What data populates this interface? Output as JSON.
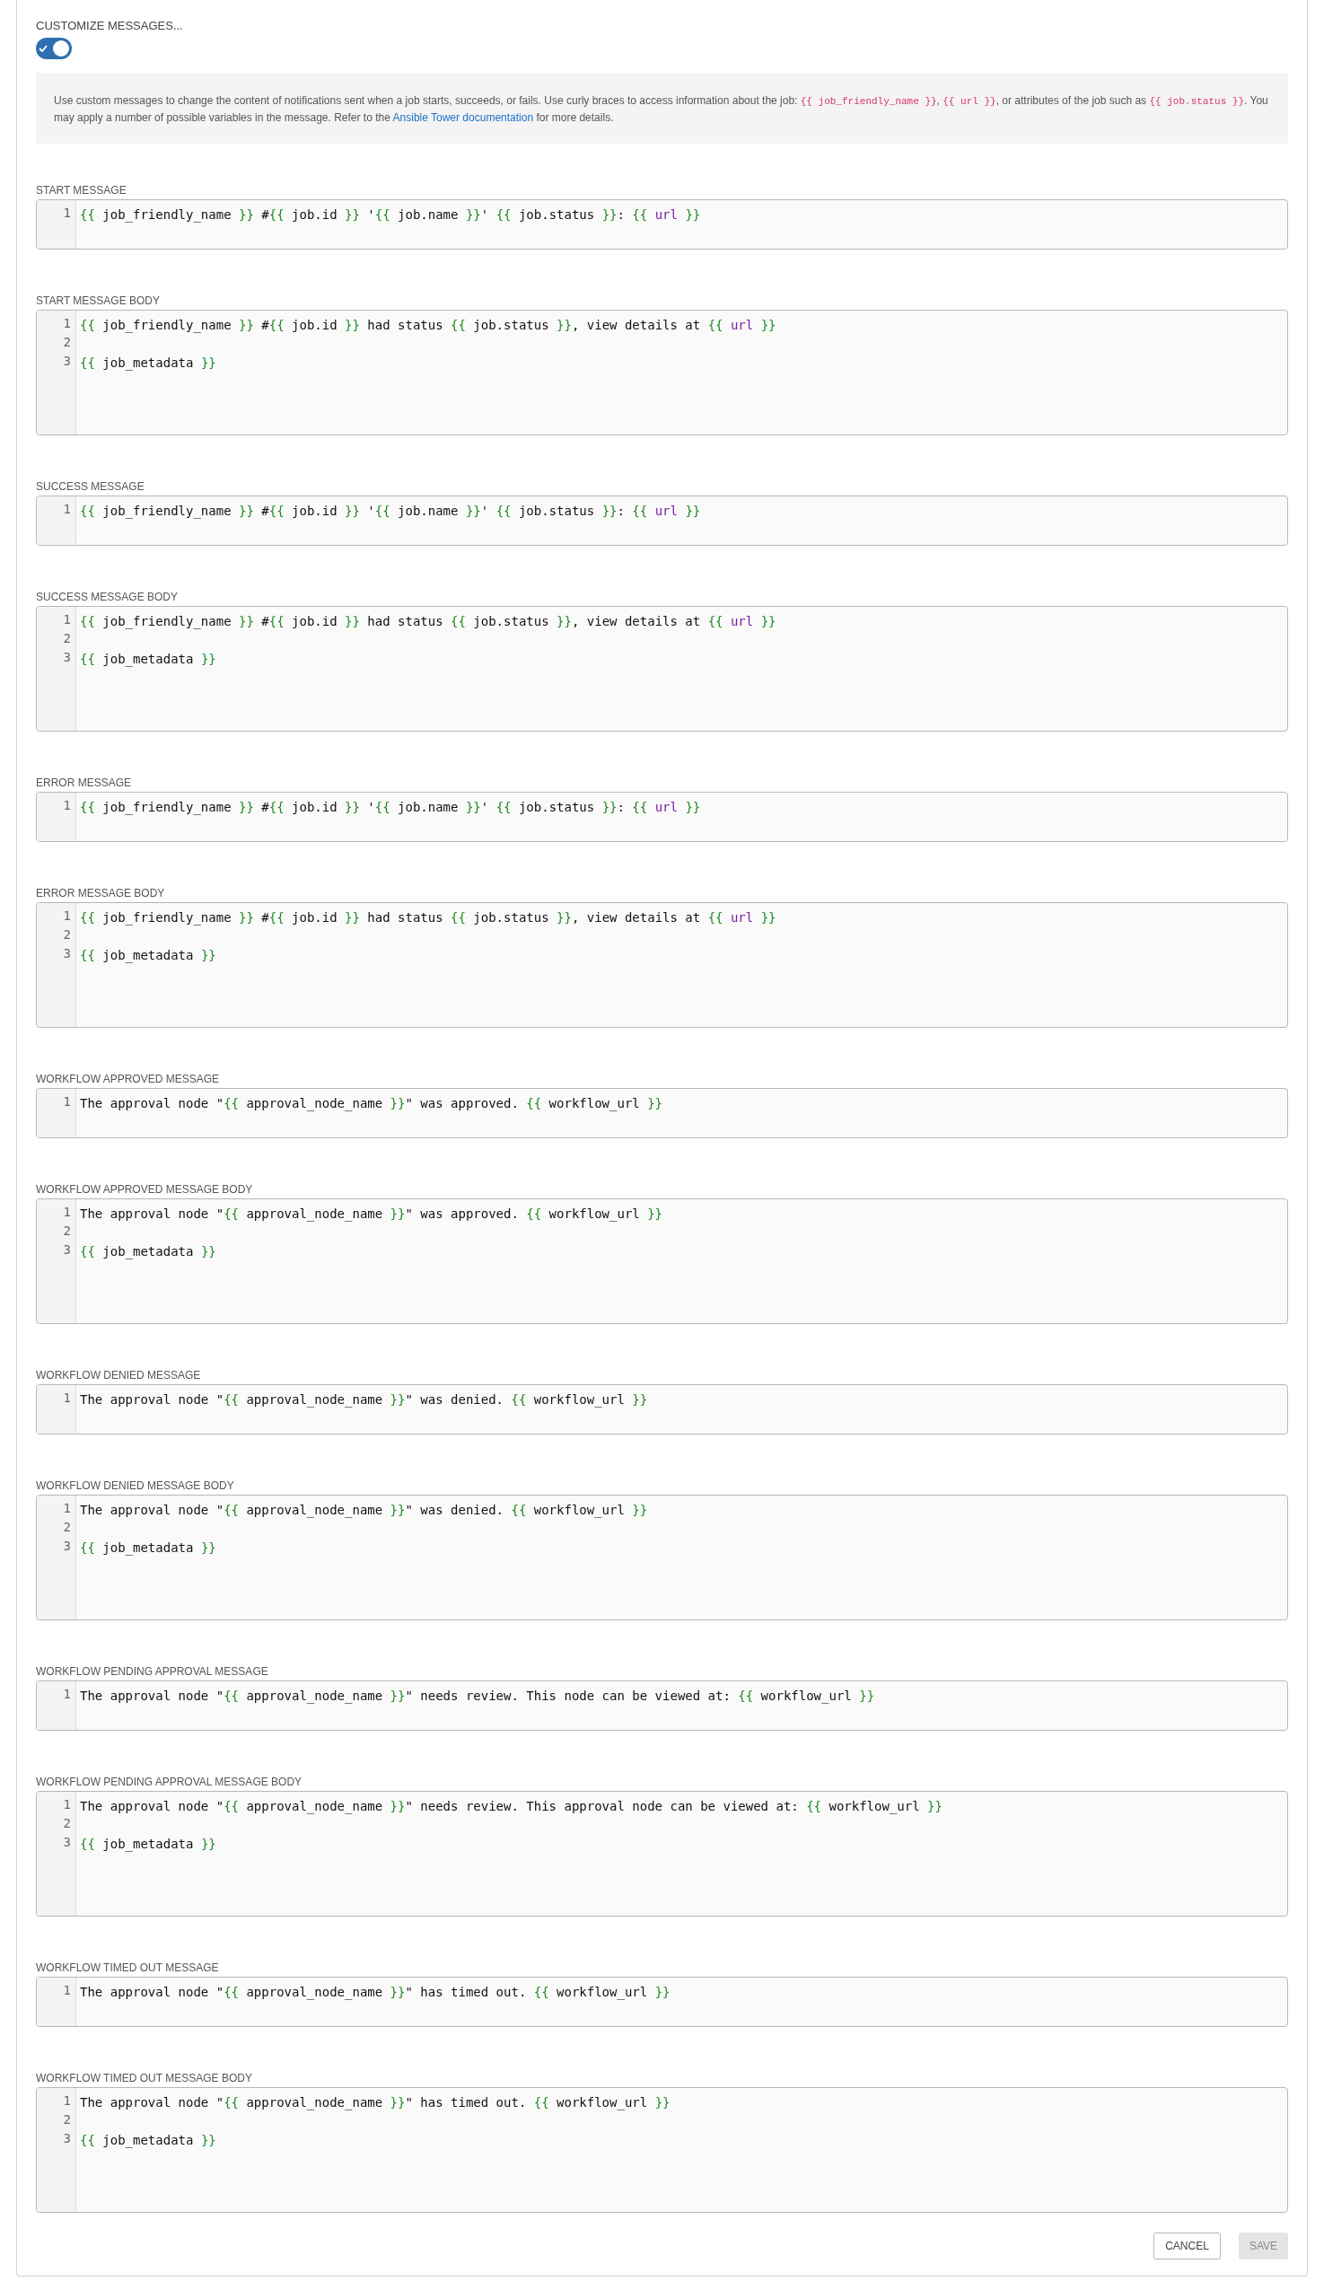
{
  "customize": {
    "label": "CUSTOMIZE MESSAGES...",
    "on": true
  },
  "info": [
    {
      "kind": "text",
      "text": "Use custom messages to change the content of notifications sent when a job starts, succeeds, or fails. Use curly braces to access information about the job: "
    },
    {
      "kind": "code",
      "text": "{{ job_friendly_name }}"
    },
    {
      "kind": "text",
      "text": ", "
    },
    {
      "kind": "code",
      "text": "{{ url }}"
    },
    {
      "kind": "text",
      "text": ", or attributes of the job such as "
    },
    {
      "kind": "code",
      "text": "{{ job.status }}"
    },
    {
      "kind": "text",
      "text": ". You may apply a number of possible variables in the message. Refer to the "
    },
    {
      "kind": "link",
      "text": "Ansible Tower documentation"
    },
    {
      "kind": "text",
      "text": " for more details."
    }
  ],
  "messages": [
    {
      "label": "START MESSAGE",
      "kind": "subject",
      "lines": [
        {
          "number": "1",
          "segments": [
            {
              "kind": "brace",
              "text": "{{"
            },
            {
              "kind": "plain",
              "text": " job_friendly_name "
            },
            {
              "kind": "brace",
              "text": "}}"
            },
            {
              "kind": "plain",
              "text": " #"
            },
            {
              "kind": "brace",
              "text": "{{"
            },
            {
              "kind": "plain",
              "text": " job.id "
            },
            {
              "kind": "brace",
              "text": "}}"
            },
            {
              "kind": "plain",
              "text": " '"
            },
            {
              "kind": "brace",
              "text": "{{"
            },
            {
              "kind": "plain",
              "text": " job.name "
            },
            {
              "kind": "brace",
              "text": "}}"
            },
            {
              "kind": "plain",
              "text": "' "
            },
            {
              "kind": "brace",
              "text": "{{"
            },
            {
              "kind": "plain",
              "text": " job.status "
            },
            {
              "kind": "brace",
              "text": "}}"
            },
            {
              "kind": "plain",
              "text": ": "
            },
            {
              "kind": "brace",
              "text": "{{ "
            },
            {
              "kind": "keyword",
              "text": "url"
            },
            {
              "kind": "brace",
              "text": " }}"
            }
          ]
        }
      ]
    },
    {
      "label": "START MESSAGE BODY",
      "kind": "body",
      "lines": [
        {
          "number": "1",
          "segments": [
            {
              "kind": "brace",
              "text": "{{"
            },
            {
              "kind": "plain",
              "text": " job_friendly_name "
            },
            {
              "kind": "brace",
              "text": "}}"
            },
            {
              "kind": "plain",
              "text": " #"
            },
            {
              "kind": "brace",
              "text": "{{"
            },
            {
              "kind": "plain",
              "text": " job.id "
            },
            {
              "kind": "brace",
              "text": "}}"
            },
            {
              "kind": "plain",
              "text": " had status "
            },
            {
              "kind": "brace",
              "text": "{{"
            },
            {
              "kind": "plain",
              "text": " job.status "
            },
            {
              "kind": "brace",
              "text": "}}"
            },
            {
              "kind": "plain",
              "text": ", view details at "
            },
            {
              "kind": "brace",
              "text": "{{ "
            },
            {
              "kind": "keyword",
              "text": "url"
            },
            {
              "kind": "brace",
              "text": " }}"
            }
          ]
        },
        {
          "number": "2"
        },
        {
          "number": "3",
          "segments": [
            {
              "kind": "brace",
              "text": "{{"
            },
            {
              "kind": "plain",
              "text": " job_metadata "
            },
            {
              "kind": "brace",
              "text": "}}"
            }
          ]
        }
      ]
    },
    {
      "label": "SUCCESS MESSAGE",
      "kind": "subject",
      "lines": [
        {
          "number": "1",
          "segments": [
            {
              "kind": "brace",
              "text": "{{"
            },
            {
              "kind": "plain",
              "text": " job_friendly_name "
            },
            {
              "kind": "brace",
              "text": "}}"
            },
            {
              "kind": "plain",
              "text": " #"
            },
            {
              "kind": "brace",
              "text": "{{"
            },
            {
              "kind": "plain",
              "text": " job.id "
            },
            {
              "kind": "brace",
              "text": "}}"
            },
            {
              "kind": "plain",
              "text": " '"
            },
            {
              "kind": "brace",
              "text": "{{"
            },
            {
              "kind": "plain",
              "text": " job.name "
            },
            {
              "kind": "brace",
              "text": "}}"
            },
            {
              "kind": "plain",
              "text": "' "
            },
            {
              "kind": "brace",
              "text": "{{"
            },
            {
              "kind": "plain",
              "text": " job.status "
            },
            {
              "kind": "brace",
              "text": "}}"
            },
            {
              "kind": "plain",
              "text": ": "
            },
            {
              "kind": "brace",
              "text": "{{ "
            },
            {
              "kind": "keyword",
              "text": "url"
            },
            {
              "kind": "brace",
              "text": " }}"
            }
          ]
        }
      ]
    },
    {
      "label": "SUCCESS MESSAGE BODY",
      "kind": "body",
      "lines": [
        {
          "number": "1",
          "segments": [
            {
              "kind": "brace",
              "text": "{{"
            },
            {
              "kind": "plain",
              "text": " job_friendly_name "
            },
            {
              "kind": "brace",
              "text": "}}"
            },
            {
              "kind": "plain",
              "text": " #"
            },
            {
              "kind": "brace",
              "text": "{{"
            },
            {
              "kind": "plain",
              "text": " job.id "
            },
            {
              "kind": "brace",
              "text": "}}"
            },
            {
              "kind": "plain",
              "text": " had status "
            },
            {
              "kind": "brace",
              "text": "{{"
            },
            {
              "kind": "plain",
              "text": " job.status "
            },
            {
              "kind": "brace",
              "text": "}}"
            },
            {
              "kind": "plain",
              "text": ", view details at "
            },
            {
              "kind": "brace",
              "text": "{{ "
            },
            {
              "kind": "keyword",
              "text": "url"
            },
            {
              "kind": "brace",
              "text": " }}"
            }
          ]
        },
        {
          "number": "2"
        },
        {
          "number": "3",
          "segments": [
            {
              "kind": "brace",
              "text": "{{"
            },
            {
              "kind": "plain",
              "text": " job_metadata "
            },
            {
              "kind": "brace",
              "text": "}}"
            }
          ]
        }
      ]
    },
    {
      "label": "ERROR MESSAGE",
      "kind": "subject",
      "lines": [
        {
          "number": "1",
          "segments": [
            {
              "kind": "brace",
              "text": "{{"
            },
            {
              "kind": "plain",
              "text": " job_friendly_name "
            },
            {
              "kind": "brace",
              "text": "}}"
            },
            {
              "kind": "plain",
              "text": " #"
            },
            {
              "kind": "brace",
              "text": "{{"
            },
            {
              "kind": "plain",
              "text": " job.id "
            },
            {
              "kind": "brace",
              "text": "}}"
            },
            {
              "kind": "plain",
              "text": " '"
            },
            {
              "kind": "brace",
              "text": "{{"
            },
            {
              "kind": "plain",
              "text": " job.name "
            },
            {
              "kind": "brace",
              "text": "}}"
            },
            {
              "kind": "plain",
              "text": "' "
            },
            {
              "kind": "brace",
              "text": "{{"
            },
            {
              "kind": "plain",
              "text": " job.status "
            },
            {
              "kind": "brace",
              "text": "}}"
            },
            {
              "kind": "plain",
              "text": ": "
            },
            {
              "kind": "brace",
              "text": "{{ "
            },
            {
              "kind": "keyword",
              "text": "url"
            },
            {
              "kind": "brace",
              "text": " }}"
            }
          ]
        }
      ]
    },
    {
      "label": "ERROR MESSAGE BODY",
      "kind": "body",
      "lines": [
        {
          "number": "1",
          "segments": [
            {
              "kind": "brace",
              "text": "{{"
            },
            {
              "kind": "plain",
              "text": " job_friendly_name "
            },
            {
              "kind": "brace",
              "text": "}}"
            },
            {
              "kind": "plain",
              "text": " #"
            },
            {
              "kind": "brace",
              "text": "{{"
            },
            {
              "kind": "plain",
              "text": " job.id "
            },
            {
              "kind": "brace",
              "text": "}}"
            },
            {
              "kind": "plain",
              "text": " had status "
            },
            {
              "kind": "brace",
              "text": "{{"
            },
            {
              "kind": "plain",
              "text": " job.status "
            },
            {
              "kind": "brace",
              "text": "}}"
            },
            {
              "kind": "plain",
              "text": ", view details at "
            },
            {
              "kind": "brace",
              "text": "{{ "
            },
            {
              "kind": "keyword",
              "text": "url"
            },
            {
              "kind": "brace",
              "text": " }}"
            }
          ]
        },
        {
          "number": "2"
        },
        {
          "number": "3",
          "segments": [
            {
              "kind": "brace",
              "text": "{{"
            },
            {
              "kind": "plain",
              "text": " job_metadata "
            },
            {
              "kind": "brace",
              "text": "}}"
            }
          ]
        }
      ]
    },
    {
      "label": "WORKFLOW APPROVED MESSAGE",
      "kind": "subject",
      "lines": [
        {
          "number": "1",
          "segments": [
            {
              "kind": "plain",
              "text": "The approval node \""
            },
            {
              "kind": "brace",
              "text": "{{"
            },
            {
              "kind": "plain",
              "text": " approval_node_name "
            },
            {
              "kind": "brace",
              "text": "}}"
            },
            {
              "kind": "plain",
              "text": "\" was approved. "
            },
            {
              "kind": "brace",
              "text": "{{"
            },
            {
              "kind": "plain",
              "text": " workflow_url "
            },
            {
              "kind": "brace",
              "text": "}}"
            }
          ]
        }
      ]
    },
    {
      "label": "WORKFLOW APPROVED MESSAGE BODY",
      "kind": "body",
      "lines": [
        {
          "number": "1",
          "segments": [
            {
              "kind": "plain",
              "text": "The approval node \""
            },
            {
              "kind": "brace",
              "text": "{{"
            },
            {
              "kind": "plain",
              "text": " approval_node_name "
            },
            {
              "kind": "brace",
              "text": "}}"
            },
            {
              "kind": "plain",
              "text": "\" was approved. "
            },
            {
              "kind": "brace",
              "text": "{{"
            },
            {
              "kind": "plain",
              "text": " workflow_url "
            },
            {
              "kind": "brace",
              "text": "}}"
            }
          ]
        },
        {
          "number": "2"
        },
        {
          "number": "3",
          "segments": [
            {
              "kind": "brace",
              "text": "{{"
            },
            {
              "kind": "plain",
              "text": " job_metadata "
            },
            {
              "kind": "brace",
              "text": "}}"
            }
          ]
        }
      ]
    },
    {
      "label": "WORKFLOW DENIED MESSAGE",
      "kind": "subject",
      "lines": [
        {
          "number": "1",
          "segments": [
            {
              "kind": "plain",
              "text": "The approval node \""
            },
            {
              "kind": "brace",
              "text": "{{"
            },
            {
              "kind": "plain",
              "text": " approval_node_name "
            },
            {
              "kind": "brace",
              "text": "}}"
            },
            {
              "kind": "plain",
              "text": "\" was denied. "
            },
            {
              "kind": "brace",
              "text": "{{"
            },
            {
              "kind": "plain",
              "text": " workflow_url "
            },
            {
              "kind": "brace",
              "text": "}}"
            }
          ]
        }
      ]
    },
    {
      "label": "WORKFLOW DENIED MESSAGE BODY",
      "kind": "body",
      "lines": [
        {
          "number": "1",
          "segments": [
            {
              "kind": "plain",
              "text": "The approval node \""
            },
            {
              "kind": "brace",
              "text": "{{"
            },
            {
              "kind": "plain",
              "text": " approval_node_name "
            },
            {
              "kind": "brace",
              "text": "}}"
            },
            {
              "kind": "plain",
              "text": "\" was denied. "
            },
            {
              "kind": "brace",
              "text": "{{"
            },
            {
              "kind": "plain",
              "text": " workflow_url "
            },
            {
              "kind": "brace",
              "text": "}}"
            }
          ]
        },
        {
          "number": "2"
        },
        {
          "number": "3",
          "segments": [
            {
              "kind": "brace",
              "text": "{{"
            },
            {
              "kind": "plain",
              "text": " job_metadata "
            },
            {
              "kind": "brace",
              "text": "}}"
            }
          ]
        }
      ]
    },
    {
      "label": "WORKFLOW PENDING APPROVAL MESSAGE",
      "kind": "subject",
      "lines": [
        {
          "number": "1",
          "segments": [
            {
              "kind": "plain",
              "text": "The approval node \""
            },
            {
              "kind": "brace",
              "text": "{{"
            },
            {
              "kind": "plain",
              "text": " approval_node_name "
            },
            {
              "kind": "brace",
              "text": "}}"
            },
            {
              "kind": "plain",
              "text": "\" needs review. This node can be viewed at: "
            },
            {
              "kind": "brace",
              "text": "{{"
            },
            {
              "kind": "plain",
              "text": " workflow_url "
            },
            {
              "kind": "brace",
              "text": "}}"
            }
          ]
        }
      ]
    },
    {
      "label": "WORKFLOW PENDING APPROVAL MESSAGE BODY",
      "kind": "body",
      "lines": [
        {
          "number": "1",
          "segments": [
            {
              "kind": "plain",
              "text": "The approval node \""
            },
            {
              "kind": "brace",
              "text": "{{"
            },
            {
              "kind": "plain",
              "text": " approval_node_name "
            },
            {
              "kind": "brace",
              "text": "}}"
            },
            {
              "kind": "plain",
              "text": "\" needs review. This approval node can be viewed at: "
            },
            {
              "kind": "brace",
              "text": "{{"
            },
            {
              "kind": "plain",
              "text": " workflow_url "
            },
            {
              "kind": "brace",
              "text": "}}"
            }
          ]
        },
        {
          "number": "2"
        },
        {
          "number": "3",
          "segments": [
            {
              "kind": "brace",
              "text": "{{"
            },
            {
              "kind": "plain",
              "text": " job_metadata "
            },
            {
              "kind": "brace",
              "text": "}}"
            }
          ]
        }
      ]
    },
    {
      "label": "WORKFLOW TIMED OUT MESSAGE",
      "kind": "subject",
      "lines": [
        {
          "number": "1",
          "segments": [
            {
              "kind": "plain",
              "text": "The approval node \""
            },
            {
              "kind": "brace",
              "text": "{{"
            },
            {
              "kind": "plain",
              "text": " approval_node_name "
            },
            {
              "kind": "brace",
              "text": "}}"
            },
            {
              "kind": "plain",
              "text": "\" has timed out. "
            },
            {
              "kind": "brace",
              "text": "{{"
            },
            {
              "kind": "plain",
              "text": " workflow_url "
            },
            {
              "kind": "brace",
              "text": "}}"
            }
          ]
        }
      ]
    },
    {
      "label": "WORKFLOW TIMED OUT MESSAGE BODY",
      "kind": "body",
      "lines": [
        {
          "number": "1",
          "segments": [
            {
              "kind": "plain",
              "text": "The approval node \""
            },
            {
              "kind": "brace",
              "text": "{{"
            },
            {
              "kind": "plain",
              "text": " approval_node_name "
            },
            {
              "kind": "brace",
              "text": "}}"
            },
            {
              "kind": "plain",
              "text": "\" has timed out. "
            },
            {
              "kind": "brace",
              "text": "{{"
            },
            {
              "kind": "plain",
              "text": " workflow_url "
            },
            {
              "kind": "brace",
              "text": "}}"
            }
          ]
        },
        {
          "number": "2"
        },
        {
          "number": "3",
          "segments": [
            {
              "kind": "brace",
              "text": "{{"
            },
            {
              "kind": "plain",
              "text": " job_metadata "
            },
            {
              "kind": "brace",
              "text": "}}"
            }
          ]
        }
      ]
    }
  ],
  "buttons": [
    {
      "label": "CANCEL",
      "disabled": false
    },
    {
      "label": "SAVE",
      "disabled": true
    }
  ]
}
